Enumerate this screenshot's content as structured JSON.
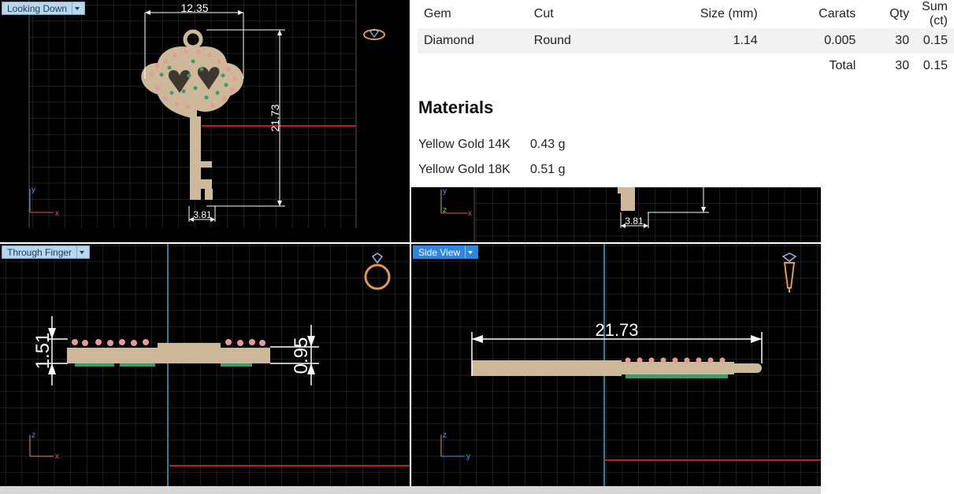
{
  "viewports": {
    "top": {
      "label": "Looking Down",
      "dims": {
        "width": "12.35",
        "height": "21.73",
        "stem": "3.81"
      },
      "axes": {
        "vertical": "y",
        "horizontal": "x"
      }
    },
    "partial": {
      "dims": {
        "stem": "3.81"
      },
      "axes": {
        "vertical": "y",
        "horizontal": "z"
      }
    },
    "front": {
      "label": "Through Finger",
      "dims": {
        "thickness": "1.51",
        "plate": "0.95"
      },
      "axes": {
        "vertical": "z",
        "horizontal": "x"
      }
    },
    "side": {
      "label": "Side View",
      "dims": {
        "length": "21.73"
      },
      "axes": {
        "vertical": "z",
        "horizontal": "y"
      }
    }
  },
  "report": {
    "columns": [
      "Gem",
      "Cut",
      "Size (mm)",
      "Carats",
      "Qty",
      "Sum (ct)"
    ],
    "rows": [
      {
        "gem": "Diamond",
        "cut": "Round",
        "size": "1.14",
        "carats": "0.005",
        "qty": "30",
        "sum": "0.15"
      }
    ],
    "total": {
      "label": "Total",
      "qty": "30",
      "sum": "0.15"
    },
    "materials_title": "Materials",
    "materials": [
      {
        "name": "Yellow Gold 14K",
        "weight": "0.43 g"
      },
      {
        "name": "Yellow Gold 18K",
        "weight": "0.51 g"
      }
    ]
  },
  "colors": {
    "grid": "#3c3c3c",
    "metal": "#cdb89a",
    "gem_pink": "#e69a9a",
    "gem_green": "#3f9a6e",
    "ground_line": "#c02020",
    "axis_line": "#2a7fa0",
    "label_active": "#2e86de"
  },
  "icons": [
    "ring-icon",
    "ring-side-icon",
    "ring-top-icon"
  ]
}
